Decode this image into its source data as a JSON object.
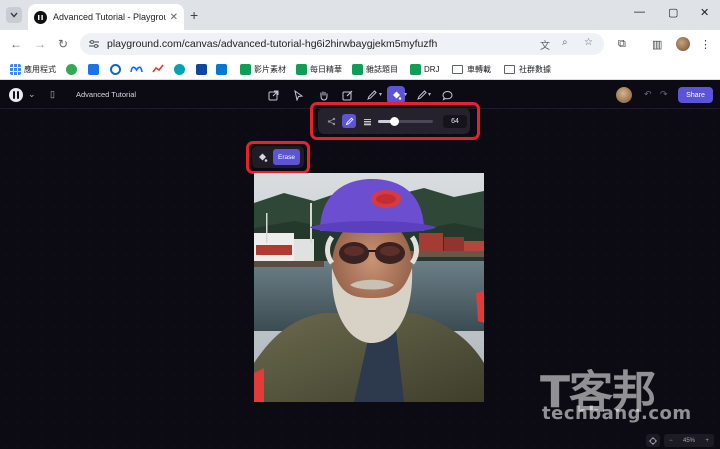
{
  "browser": {
    "tab_title": "Advanced Tutorial - Playgrou",
    "tab_close": "✕",
    "new_tab": "+",
    "url": "playground.com/canvas/advanced-tutorial-hg6i2hirwbaygjekm5myfuzfh",
    "window_controls": [
      "—",
      "▢",
      "✕"
    ]
  },
  "bookmarks": [
    {
      "label": "應用程式",
      "icon": "apps-grid-icon",
      "color": "#4285f4"
    },
    {
      "label": "",
      "icon": "puzzle-icon",
      "color": "#34a853"
    },
    {
      "label": "",
      "icon": "blue-square-icon",
      "color": "#1a73e8"
    },
    {
      "label": "",
      "icon": "circle-c-icon",
      "color": "#1565c0"
    },
    {
      "label": "",
      "icon": "meta-icon",
      "color": "#0866ff"
    },
    {
      "label": "",
      "icon": "trend-icon",
      "color": "#e53935"
    },
    {
      "label": "",
      "icon": "teal-circle-icon",
      "color": "#00a3b4"
    },
    {
      "label": "",
      "icon": "navy-square-icon",
      "color": "#0d47a1"
    },
    {
      "label": "",
      "icon": "outlook-icon",
      "color": "#0078d4"
    },
    {
      "label": "影片素材",
      "icon": "green-plus-icon",
      "color": "#0f9d58"
    },
    {
      "label": "每日精華",
      "icon": "green-plus-icon",
      "color": "#0f9d58"
    },
    {
      "label": "雜誌題目",
      "icon": "green-plus-icon",
      "color": "#0f9d58"
    },
    {
      "label": "DRJ",
      "icon": "green-plus-icon",
      "color": "#0f9d58"
    },
    {
      "label": "車轉載",
      "icon": "folder-icon",
      "color": "#5f6368"
    },
    {
      "label": "社群數據",
      "icon": "folder-icon",
      "color": "#5f6368"
    }
  ],
  "app": {
    "project_title": "Advanced Tutorial",
    "share_label": "Share",
    "accent": "#5b54d6"
  },
  "brush_toolbar": {
    "brush_size": "64",
    "slider_value": 0.3
  },
  "eraser": {
    "label": "Erase"
  },
  "zoom": {
    "minus": "−",
    "level": "45%",
    "plus": "+"
  },
  "watermark": {
    "brand_cn": "T客邦",
    "brand_en": "techbang.com"
  },
  "highlight_color": "#e8202f"
}
